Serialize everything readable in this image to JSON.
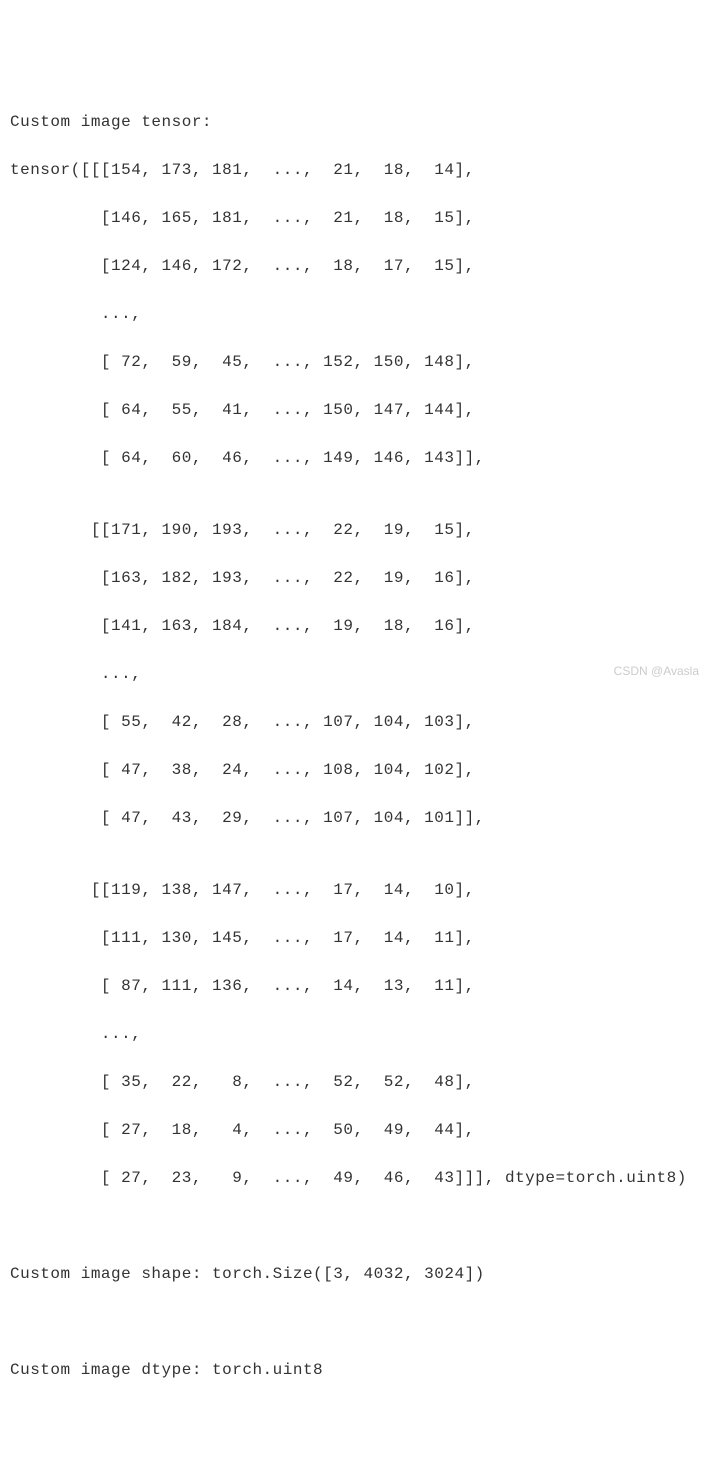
{
  "header": "Custom image tensor:",
  "tensor_lines": [
    "tensor([[[154, 173, 181,  ...,  21,  18,  14],",
    "         [146, 165, 181,  ...,  21,  18,  15],",
    "         [124, 146, 172,  ...,  18,  17,  15],",
    "         ...,",
    "         [ 72,  59,  45,  ..., 152, 150, 148],",
    "         [ 64,  55,  41,  ..., 150, 147, 144],",
    "         [ 64,  60,  46,  ..., 149, 146, 143]],",
    "",
    "        [[171, 190, 193,  ...,  22,  19,  15],",
    "         [163, 182, 193,  ...,  22,  19,  16],",
    "         [141, 163, 184,  ...,  19,  18,  16],",
    "         ...,",
    "         [ 55,  42,  28,  ..., 107, 104, 103],",
    "         [ 47,  38,  24,  ..., 108, 104, 102],",
    "         [ 47,  43,  29,  ..., 107, 104, 101]],",
    "",
    "        [[119, 138, 147,  ...,  17,  14,  10],",
    "         [111, 130, 145,  ...,  17,  14,  11],",
    "         [ 87, 111, 136,  ...,  14,  13,  11],",
    "         ...,",
    "         [ 35,  22,   8,  ...,  52,  52,  48],",
    "         [ 27,  18,   4,  ...,  50,  49,  44],",
    "         [ 27,  23,   9,  ...,  49,  46,  43]]], dtype=torch.uint8)"
  ],
  "shape_line": "Custom image shape: torch.Size([3, 4032, 3024])",
  "dtype_line": "Custom image dtype: torch.uint8",
  "watermark": "CSDN @Avasla",
  "chart_data": {
    "type": "table",
    "description": "3D tensor printout (truncated) with dtype torch.uint8",
    "tensor_shape": [
      3,
      4032,
      3024
    ],
    "dtype": "torch.uint8",
    "channels": [
      {
        "channel_index": 0,
        "top_rows": [
          {
            "head": [
              154,
              173,
              181
            ],
            "tail": [
              21,
              18,
              14
            ]
          },
          {
            "head": [
              146,
              165,
              181
            ],
            "tail": [
              21,
              18,
              15
            ]
          },
          {
            "head": [
              124,
              146,
              172
            ],
            "tail": [
              18,
              17,
              15
            ]
          }
        ],
        "bottom_rows": [
          {
            "head": [
              72,
              59,
              45
            ],
            "tail": [
              152,
              150,
              148
            ]
          },
          {
            "head": [
              64,
              55,
              41
            ],
            "tail": [
              150,
              147,
              144
            ]
          },
          {
            "head": [
              64,
              60,
              46
            ],
            "tail": [
              149,
              146,
              143
            ]
          }
        ]
      },
      {
        "channel_index": 1,
        "top_rows": [
          {
            "head": [
              171,
              190,
              193
            ],
            "tail": [
              22,
              19,
              15
            ]
          },
          {
            "head": [
              163,
              182,
              193
            ],
            "tail": [
              22,
              19,
              16
            ]
          },
          {
            "head": [
              141,
              163,
              184
            ],
            "tail": [
              19,
              18,
              16
            ]
          }
        ],
        "bottom_rows": [
          {
            "head": [
              55,
              42,
              28
            ],
            "tail": [
              107,
              104,
              103
            ]
          },
          {
            "head": [
              47,
              38,
              24
            ],
            "tail": [
              108,
              104,
              102
            ]
          },
          {
            "head": [
              47,
              43,
              29
            ],
            "tail": [
              107,
              104,
              101
            ]
          }
        ]
      },
      {
        "channel_index": 2,
        "top_rows": [
          {
            "head": [
              119,
              138,
              147
            ],
            "tail": [
              17,
              14,
              10
            ]
          },
          {
            "head": [
              111,
              130,
              145
            ],
            "tail": [
              17,
              14,
              11
            ]
          },
          {
            "head": [
              87,
              111,
              136
            ],
            "tail": [
              14,
              13,
              11
            ]
          }
        ],
        "bottom_rows": [
          {
            "head": [
              35,
              22,
              8
            ],
            "tail": [
              52,
              52,
              48
            ]
          },
          {
            "head": [
              27,
              18,
              4
            ],
            "tail": [
              50,
              49,
              44
            ]
          },
          {
            "head": [
              27,
              23,
              9
            ],
            "tail": [
              49,
              46,
              43
            ]
          }
        ]
      }
    ]
  }
}
